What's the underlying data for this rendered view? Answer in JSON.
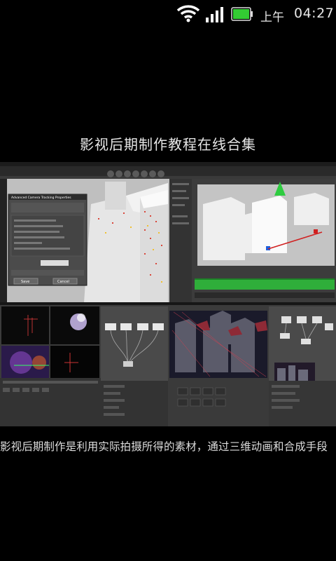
{
  "status_bar": {
    "ampm": "上午",
    "time": "04:27",
    "icons": [
      "wifi-icon",
      "signal-icon",
      "battery-icon"
    ],
    "battery_color": "#33cc33"
  },
  "article": {
    "title": "影视后期制作教程在线合集",
    "body": "影视后期制作是利用实际拍摄所得的素材，通过三维动画和合成手段",
    "image": {
      "top_dialog_title": "Advanced Camera Tracking Properties",
      "top_field_value": "3000",
      "top_button_ok": "Save",
      "top_button_cancel": "Cancel"
    }
  }
}
